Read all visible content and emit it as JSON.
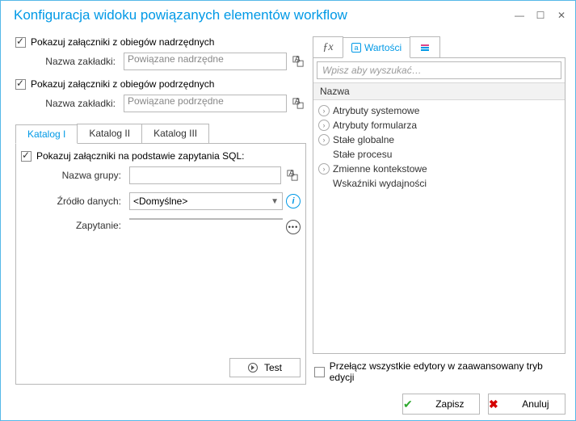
{
  "title": "Konfiguracja widoku powiązanych elementów workflow",
  "left": {
    "parent_chk": "Pokazuj załączniki z obiegów nadrzędnych",
    "tab_label": "Nazwa zakładki:",
    "parent_val": "Powiązane nadrzędne",
    "child_chk": "Pokazuj załączniki z obiegów podrzędnych",
    "child_val": "Powiązane podrzędne",
    "tabs": [
      "Katalog I",
      "Katalog II",
      "Katalog III"
    ],
    "sql_chk": "Pokazuj załączniki na podstawie zapytania SQL:",
    "group_lbl": "Nazwa grupy:",
    "source_lbl": "Źródło danych:",
    "source_val": "<Domyślne>",
    "query_lbl": "Zapytanie:",
    "test_btn": "Test"
  },
  "right": {
    "tab_values": "Wartości",
    "search_ph": "Wpisz aby wyszukać…",
    "header": "Nazwa",
    "items": [
      {
        "label": "Atrybuty systemowe",
        "exp": true
      },
      {
        "label": "Atrybuty formularza",
        "exp": true
      },
      {
        "label": "Stałe globalne",
        "exp": true
      },
      {
        "label": "Stałe procesu",
        "exp": false
      },
      {
        "label": "Zmienne kontekstowe",
        "exp": true
      },
      {
        "label": "Wskaźniki wydajności",
        "exp": false
      }
    ],
    "adv_chk": "Przełącz wszystkie edytory w zaawansowany tryb edycji"
  },
  "footer": {
    "save": "Zapisz",
    "cancel": "Anuluj"
  }
}
